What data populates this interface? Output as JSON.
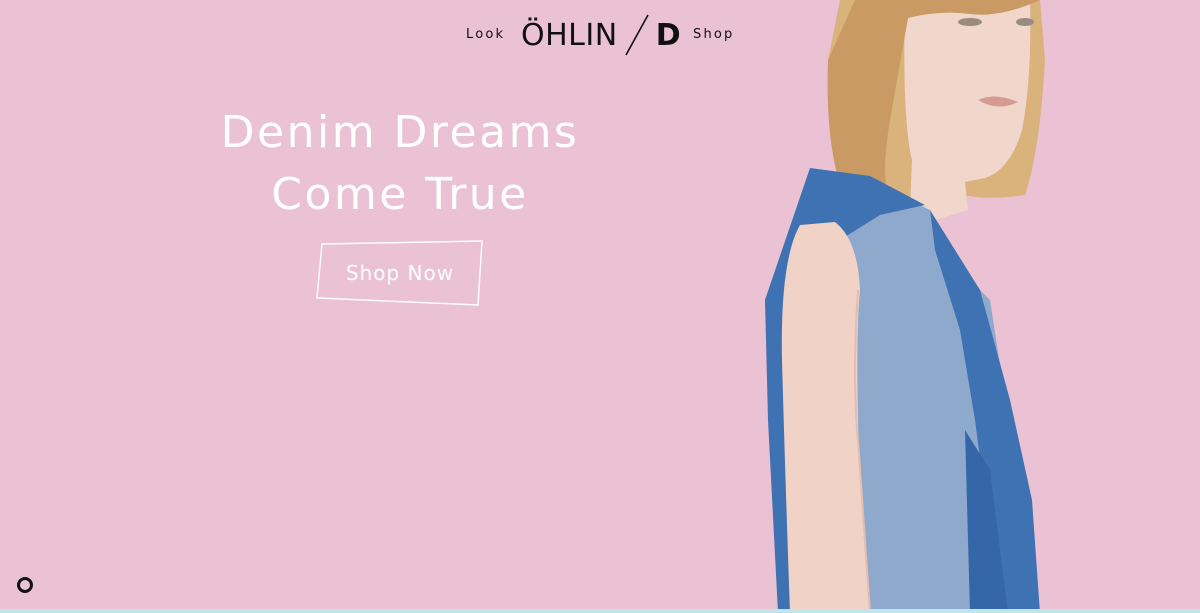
{
  "header": {
    "nav_left": "Look",
    "nav_right": "Shop",
    "logo": {
      "word": "ÖHLIN",
      "separator": "/",
      "letter": "D"
    }
  },
  "hero": {
    "title_line1": "Denim Dreams",
    "title_line2": "Come True",
    "cta_label": "Shop Now"
  },
  "colors": {
    "background": "#eac2d3",
    "text_dark": "#111111",
    "text_light": "#ffffff",
    "denim_dark": "#3f72b3",
    "denim_light": "#8fa9cc",
    "hair": "#d9b27c",
    "skin": "#f1d6cc",
    "bottom_bar": "#bfe6ea"
  },
  "icons": {
    "loader": "circle-loader-icon"
  }
}
